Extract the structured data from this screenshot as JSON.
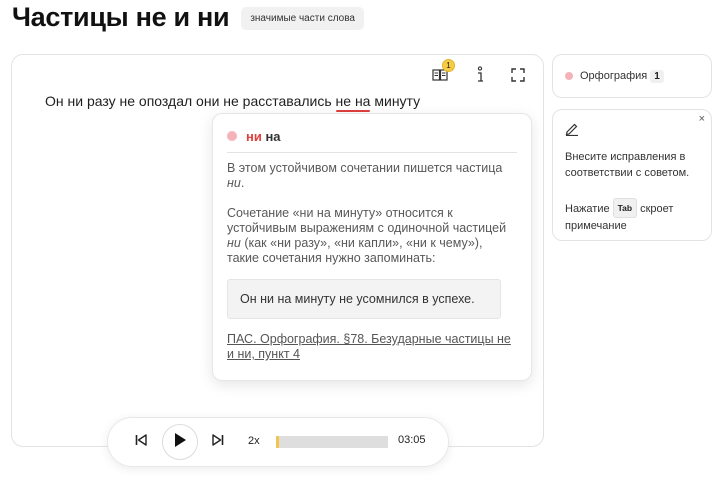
{
  "header": {
    "title": "Частицы не и ни",
    "tag": "значимые части слова"
  },
  "toolbar": {
    "book_icon": "book-icon",
    "book_badge": "1",
    "hint_icon": "info-icon",
    "fullscreen_icon": "fullscreen-icon"
  },
  "editor": {
    "sentence_before": "Он ни разу не опоздал они не расставались ",
    "sentence_error": "не на",
    "sentence_after": " минуту"
  },
  "popup": {
    "title_highlight": "ни",
    "title_rest": " на",
    "p1_start": "В этом устойчивом сочетании пишется частица ",
    "p1_italic": "ни",
    "p1_end": ".",
    "p2_start": "Сочетание «ни на минуту» относится к устойчивым выражениям с одиночной частицей ",
    "p2_italic": "ни",
    "p2_end": " (как «ни разу», «ни капли», «ни к чему»), такие сочетания нужно запоминать:",
    "example": "Он ни на минуту не усомнился в успехе.",
    "link": "ПАС. Орфография. §78. Безударные частицы не и ни, пункт 4"
  },
  "sidebar": {
    "category_label": "Орфография",
    "category_count": "1",
    "hint_line1": "Внесите исправления в соответствии с советом.",
    "hint_pre": "Нажатие",
    "hint_key": "Tab",
    "hint_post": "скроет примечание",
    "pencil_icon": "pencil-icon",
    "close_label": "×"
  },
  "player": {
    "speed": "2x",
    "time": "03:05",
    "progress": 0.02
  },
  "colors": {
    "error": "#e0403c",
    "dot": "#f4b3b8",
    "badge": "#f7cc45",
    "progress": "#f2c44b"
  }
}
